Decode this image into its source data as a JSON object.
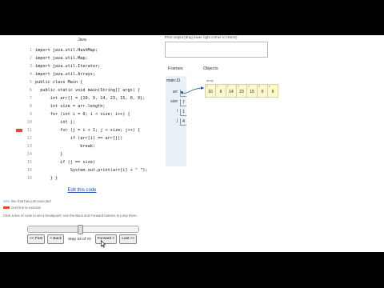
{
  "left": {
    "language": "Java",
    "code_lines": [
      {
        "num": "1",
        "text": "import java.util.HashMap;",
        "marker": "none"
      },
      {
        "num": "2",
        "text": "import java.util.Map;",
        "marker": "none"
      },
      {
        "num": "3",
        "text": "import java.util.Iterator;",
        "marker": "none"
      },
      {
        "num": "4",
        "text": "import java.util.Arrays;",
        "marker": "none"
      },
      {
        "num": "5",
        "text": "public class Main {",
        "marker": "none"
      },
      {
        "num": "6",
        "text": "  public static void main(String[] args) {",
        "marker": "none"
      },
      {
        "num": "7",
        "text": "      int arr[] = {10, 9, 14, 23, 15, 0, 9};",
        "marker": "none"
      },
      {
        "num": "8",
        "text": "      int size = arr.length;",
        "marker": "none"
      },
      {
        "num": "9",
        "text": "      for (int i = 0; i < size; i++) {",
        "marker": "none"
      },
      {
        "num": "10",
        "text": "          int j;",
        "marker": "none"
      },
      {
        "num": "11",
        "text": "          for (j = i + 1; j < size; j++) {",
        "marker": "red"
      },
      {
        "num": "12",
        "text": "              if (arr[i] == arr[j])",
        "marker": "none"
      },
      {
        "num": "13",
        "text": "                  break;",
        "marker": "none"
      },
      {
        "num": "14",
        "text": "          }",
        "marker": "none"
      },
      {
        "num": "15",
        "text": "          if (j == size)",
        "marker": "none"
      },
      {
        "num": "16",
        "text": "              System.out.print(arr[i] + \" \");",
        "marker": "none"
      },
      {
        "num": "16",
        "text": "      } }",
        "marker": "none"
      }
    ],
    "edit_link": "Edit this code",
    "legend_executed": "line that has just executed",
    "legend_next": "next line to execute",
    "hint": "Click a line of code to set a breakpoint; use the Back and Forward buttons to jump there.",
    "step_progress": 0.47,
    "buttons": {
      "first": "<< First",
      "back": "< Back",
      "step": "Step 33 of 70",
      "forward": "Forward >",
      "last": "Last >>"
    }
  },
  "right": {
    "output_label": "Print output (drag lower right corner to resize)",
    "frames_header": "Frames",
    "objects_header": "Objects",
    "frame_title": "main:11",
    "variables": [
      {
        "name": "arr",
        "value": ""
      },
      {
        "name": "size",
        "value": "7"
      },
      {
        "name": "i",
        "value": "1"
      },
      {
        "name": "j",
        "value": "4"
      }
    ],
    "array_label": "array",
    "array": [
      {
        "index": "0",
        "value": "10"
      },
      {
        "index": "1",
        "value": "9"
      },
      {
        "index": "2",
        "value": "14"
      },
      {
        "index": "3",
        "value": "23"
      },
      {
        "index": "4",
        "value": "15"
      },
      {
        "index": "5",
        "value": "0"
      },
      {
        "index": "6",
        "value": "9"
      }
    ]
  },
  "colors": {
    "next_arrow": "#e24a33",
    "executed_arrow": "#c6e0f2",
    "link": "#1e4db7",
    "array_bg": "#fdf9c8",
    "frames_bg": "#e8f0f8"
  },
  "icons": {
    "next_line": "red-arrow-icon",
    "executed_line": "light-blue-arrow-icon",
    "pointer": "mouse-pointer-icon"
  }
}
